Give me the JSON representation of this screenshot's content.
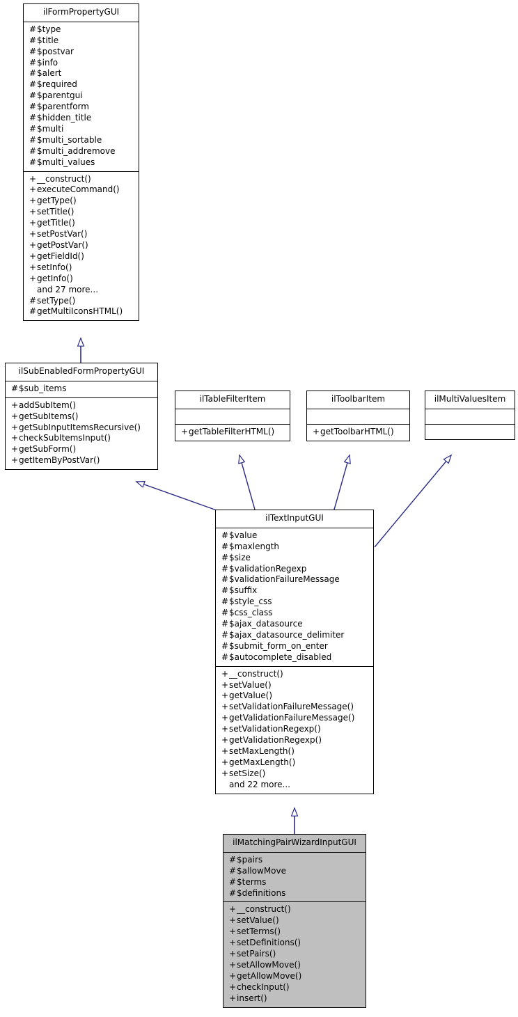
{
  "diagram": {
    "title": "ilMatchingPairWizardInputGUI inheritance diagram",
    "type": "uml-class-inheritance",
    "edge_color": "#2a2a86",
    "highlight_fill": "#bfbfbf",
    "box_fill": "#ffffff",
    "border_color": "#000000"
  },
  "classes": [
    {
      "id": "ilFormPropertyGUI",
      "name": "ilFormPropertyGUI",
      "highlighted": false,
      "attributes": [
        {
          "vis": "#",
          "text": "$type"
        },
        {
          "vis": "#",
          "text": "$title"
        },
        {
          "vis": "#",
          "text": "$postvar"
        },
        {
          "vis": "#",
          "text": "$info"
        },
        {
          "vis": "#",
          "text": "$alert"
        },
        {
          "vis": "#",
          "text": "$required"
        },
        {
          "vis": "#",
          "text": "$parentgui"
        },
        {
          "vis": "#",
          "text": "$parentform"
        },
        {
          "vis": "#",
          "text": "$hidden_title"
        },
        {
          "vis": "#",
          "text": "$multi"
        },
        {
          "vis": "#",
          "text": "$multi_sortable"
        },
        {
          "vis": "#",
          "text": "$multi_addremove"
        },
        {
          "vis": "#",
          "text": "$multi_values"
        }
      ],
      "operations": [
        {
          "vis": "+",
          "text": "__construct()"
        },
        {
          "vis": "+",
          "text": "executeCommand()"
        },
        {
          "vis": "+",
          "text": "getType()"
        },
        {
          "vis": "+",
          "text": "setTitle()"
        },
        {
          "vis": "+",
          "text": "getTitle()"
        },
        {
          "vis": "+",
          "text": "setPostVar()"
        },
        {
          "vis": "+",
          "text": "getPostVar()"
        },
        {
          "vis": "+",
          "text": "getFieldId()"
        },
        {
          "vis": "+",
          "text": "setInfo()"
        },
        {
          "vis": "+",
          "text": "getInfo()"
        },
        {
          "vis": "",
          "text": "and 27 more..."
        },
        {
          "vis": "#",
          "text": "setType()"
        },
        {
          "vis": "#",
          "text": "getMultiIconsHTML()"
        }
      ]
    },
    {
      "id": "ilSubEnabledFormPropertyGUI",
      "name": "ilSubEnabledFormPropertyGUI",
      "highlighted": false,
      "attributes": [
        {
          "vis": "#",
          "text": "$sub_items"
        }
      ],
      "operations": [
        {
          "vis": "+",
          "text": "addSubItem()"
        },
        {
          "vis": "+",
          "text": "getSubItems()"
        },
        {
          "vis": "+",
          "text": "getSubInputItemsRecursive()"
        },
        {
          "vis": "+",
          "text": "checkSubItemsInput()"
        },
        {
          "vis": "+",
          "text": "getSubForm()"
        },
        {
          "vis": "+",
          "text": "getItemByPostVar()"
        }
      ]
    },
    {
      "id": "ilTableFilterItem",
      "name": "ilTableFilterItem",
      "highlighted": false,
      "attributes": [],
      "operations": [
        {
          "vis": "+",
          "text": "getTableFilterHTML()"
        }
      ]
    },
    {
      "id": "ilToolbarItem",
      "name": "ilToolbarItem",
      "highlighted": false,
      "attributes": [],
      "operations": [
        {
          "vis": "+",
          "text": "getToolbarHTML()"
        }
      ]
    },
    {
      "id": "ilMultiValuesItem",
      "name": "ilMultiValuesItem",
      "highlighted": false,
      "attributes": [],
      "operations": []
    },
    {
      "id": "ilTextInputGUI",
      "name": "ilTextInputGUI",
      "highlighted": false,
      "attributes": [
        {
          "vis": "#",
          "text": "$value"
        },
        {
          "vis": "#",
          "text": "$maxlength"
        },
        {
          "vis": "#",
          "text": "$size"
        },
        {
          "vis": "#",
          "text": "$validationRegexp"
        },
        {
          "vis": "#",
          "text": "$validationFailureMessage"
        },
        {
          "vis": "#",
          "text": "$suffix"
        },
        {
          "vis": "#",
          "text": "$style_css"
        },
        {
          "vis": "#",
          "text": "$css_class"
        },
        {
          "vis": "#",
          "text": "$ajax_datasource"
        },
        {
          "vis": "#",
          "text": "$ajax_datasource_delimiter"
        },
        {
          "vis": "#",
          "text": "$submit_form_on_enter"
        },
        {
          "vis": "#",
          "text": "$autocomplete_disabled"
        }
      ],
      "operations": [
        {
          "vis": "+",
          "text": "__construct()"
        },
        {
          "vis": "+",
          "text": "setValue()"
        },
        {
          "vis": "+",
          "text": "getValue()"
        },
        {
          "vis": "+",
          "text": "setValidationFailureMessage()"
        },
        {
          "vis": "+",
          "text": "getValidationFailureMessage()"
        },
        {
          "vis": "+",
          "text": "setValidationRegexp()"
        },
        {
          "vis": "+",
          "text": "getValidationRegexp()"
        },
        {
          "vis": "+",
          "text": "setMaxLength()"
        },
        {
          "vis": "+",
          "text": "getMaxLength()"
        },
        {
          "vis": "+",
          "text": "setSize()"
        },
        {
          "vis": "",
          "text": "and 22 more..."
        }
      ]
    },
    {
      "id": "ilMatchingPairWizardInputGUI",
      "name": "ilMatchingPairWizardInputGUI",
      "highlighted": true,
      "attributes": [
        {
          "vis": "#",
          "text": "$pairs"
        },
        {
          "vis": "#",
          "text": "$allowMove"
        },
        {
          "vis": "#",
          "text": "$terms"
        },
        {
          "vis": "#",
          "text": "$definitions"
        }
      ],
      "operations": [
        {
          "vis": "+",
          "text": "__construct()"
        },
        {
          "vis": "+",
          "text": "setValue()"
        },
        {
          "vis": "+",
          "text": "setTerms()"
        },
        {
          "vis": "+",
          "text": "setDefinitions()"
        },
        {
          "vis": "+",
          "text": "setPairs()"
        },
        {
          "vis": "+",
          "text": "setAllowMove()"
        },
        {
          "vis": "+",
          "text": "getAllowMove()"
        },
        {
          "vis": "+",
          "text": "checkInput()"
        },
        {
          "vis": "+",
          "text": "insert()"
        }
      ]
    }
  ],
  "edges": [
    {
      "from": "ilSubEnabledFormPropertyGUI",
      "to": "ilFormPropertyGUI",
      "kind": "generalization"
    },
    {
      "from": "ilTextInputGUI",
      "to": "ilSubEnabledFormPropertyGUI",
      "kind": "generalization"
    },
    {
      "from": "ilTextInputGUI",
      "to": "ilTableFilterItem",
      "kind": "generalization"
    },
    {
      "from": "ilTextInputGUI",
      "to": "ilToolbarItem",
      "kind": "generalization"
    },
    {
      "from": "ilTextInputGUI",
      "to": "ilMultiValuesItem",
      "kind": "generalization"
    },
    {
      "from": "ilMatchingPairWizardInputGUI",
      "to": "ilTextInputGUI",
      "kind": "generalization"
    }
  ]
}
